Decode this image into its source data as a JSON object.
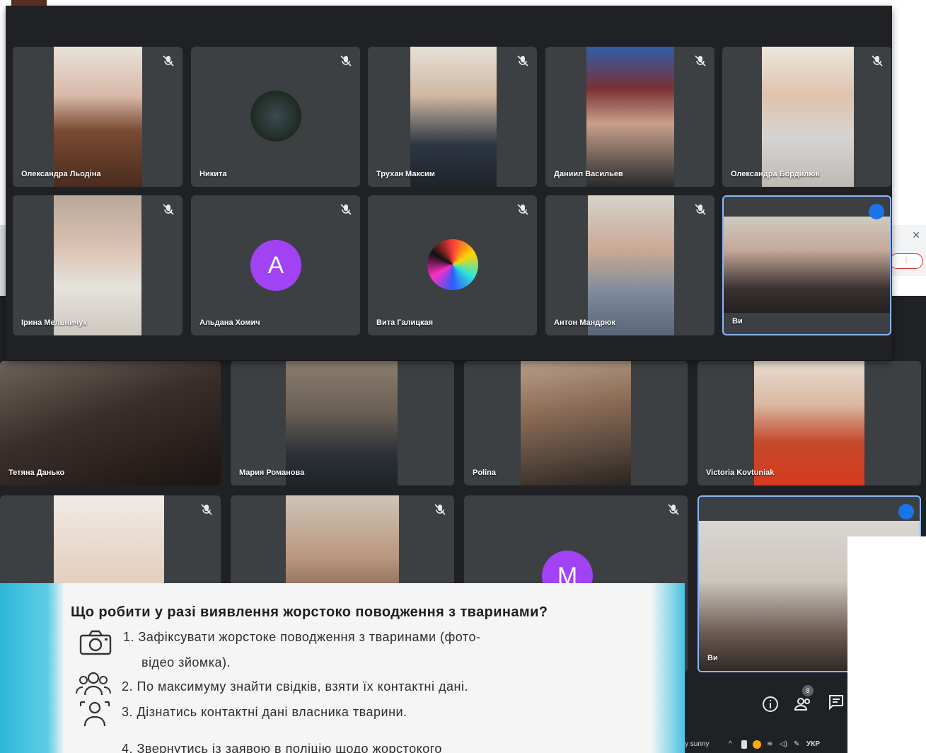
{
  "meeting_top": {
    "participants": [
      {
        "name": "Олександра Льодіна"
      },
      {
        "name": "Никита"
      },
      {
        "name": "Трухан Максим"
      },
      {
        "name": "Даниил Васильев"
      },
      {
        "name": "Олександра Бордилюк"
      },
      {
        "name": "Ірина Мельничук"
      },
      {
        "name": "Альдана Хомич",
        "avatar_letter": "A"
      },
      {
        "name": "Вита Галицкая"
      },
      {
        "name": "Антон Мандрюк"
      },
      {
        "name": "Ви"
      }
    ]
  },
  "meeting_bottom": {
    "participants": [
      {
        "name": "Тетяна Данько"
      },
      {
        "name": "Мария Романова"
      },
      {
        "name": "Polina"
      },
      {
        "name": "Victoria Kovtuniak"
      },
      {
        "name": ""
      },
      {
        "name": ""
      },
      {
        "name": "",
        "avatar_letter": "M"
      },
      {
        "name": "Ви"
      }
    ],
    "people_count": "8"
  },
  "taskbar": {
    "weather": "y sunny",
    "language": "УКР"
  },
  "slide": {
    "title": "Що робити у разі виявлення жорстоко поводження з тваринами?",
    "items": [
      "1. Зафіксувати жорстоке поводження з тваринами (фото-",
      "відео зйомка).",
      "2. По максимуму знайти свідків, взяти їх контактні дані.",
      "3. Дізнатись контактні дані власника тварини.",
      "4. Звернутись із заявою в поліцію щодо жорстокого"
    ]
  },
  "colors": {
    "meet_bg": "#202124",
    "tile_bg": "#3c4043",
    "speaking_border": "#8ab4f8",
    "avatar_purple": "#a142f4",
    "slide_cyan": "#2bb6d8"
  }
}
